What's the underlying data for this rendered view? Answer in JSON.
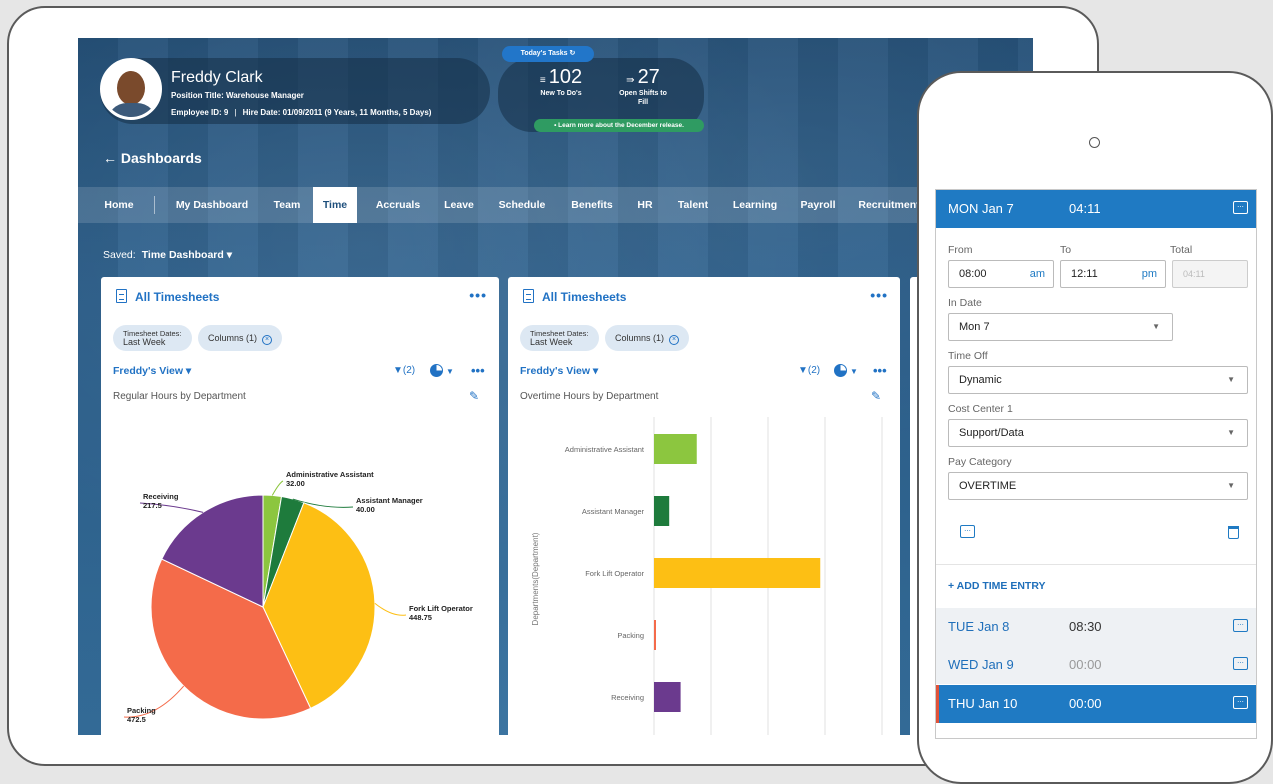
{
  "profile": {
    "name": "Freddy Clark",
    "title": "Position Title: Warehouse Manager",
    "employee_id": "Employee ID: 9",
    "hire_date": "Hire Date: 01/09/2011 (9 Years, 11 Months, 5 Days)"
  },
  "tasks": {
    "label": "Today's Tasks",
    "todos_count": "102",
    "todos_label": "New To Do's",
    "shifts_count": "27",
    "shifts_label_1": "Open Shifts to",
    "shifts_label_2": "Fill",
    "learn_more": "• Learn more about the December release."
  },
  "page": {
    "back_label": "← Dashboards",
    "saved_label": "Saved:",
    "saved_value": "Time Dashboard ▾"
  },
  "nav": [
    "Home",
    "My Dashboard",
    "Team",
    "Time",
    "Accruals",
    "Leave",
    "Schedule",
    "Benefits",
    "HR",
    "Talent",
    "Learning",
    "Payroll",
    "Recruitment"
  ],
  "nav_active": "Time",
  "cards": [
    {
      "title": "All Timesheets",
      "chip_1a": "Timesheet Dates:",
      "chip_1b": "Last Week",
      "chip_2": "Columns (1)",
      "view": "Freddy's View ▾",
      "filter": "(2)",
      "subtitle": "Regular Hours by Department"
    },
    {
      "title": "All Timesheets",
      "chip_1a": "Timesheet Dates:",
      "chip_1b": "Last Week",
      "chip_2": "Columns (1)",
      "view": "Freddy's View ▾",
      "filter": "(2)",
      "subtitle": "Overtime Hours by Department"
    }
  ],
  "chart_data": [
    {
      "type": "pie",
      "title": "Regular Hours by Department",
      "categories": [
        "Administrative Assistant",
        "Assistant Manager",
        "Fork Lift Operator",
        "Packing",
        "Receiving"
      ],
      "values": [
        32.0,
        40.0,
        448.75,
        472.5,
        217.5
      ],
      "value_labels": [
        "32.00",
        "40.00",
        "448.75",
        "472.5",
        "217.5"
      ],
      "colors": [
        "#8cc63f",
        "#1e7b3c",
        "#fdbf14",
        "#f46b4a",
        "#6b3a8e"
      ]
    },
    {
      "type": "bar",
      "orientation": "horizontal",
      "title": "Overtime Hours by Department",
      "ylabel": "Departments(Department)",
      "categories": [
        "Administrative Assistant",
        "Assistant Manager",
        "Fork Lift Operator",
        "Packing",
        "Receiving"
      ],
      "values": [
        4.5,
        1.6,
        17.5,
        0.2,
        2.8
      ],
      "colors": [
        "#8cc63f",
        "#1e7b3c",
        "#fdbf14",
        "#f46b4a",
        "#6b3a8e"
      ],
      "xlim": [
        0,
        24
      ],
      "grid": true
    }
  ],
  "phone": {
    "header_day": "MON  Jan 7",
    "header_time": "04:11",
    "from_label": "From",
    "to_label": "To",
    "total_label": "Total",
    "from_value": "08:00",
    "from_suffix": "am",
    "to_value": "12:11",
    "to_suffix": "pm",
    "total_value": "04:11",
    "in_date_label": "In Date",
    "in_date_value": "Mon 7",
    "time_off_label": "Time Off",
    "time_off_value": "Dynamic",
    "cost_center_label": "Cost Center 1",
    "cost_center_value": "Support/Data",
    "pay_category_label": "Pay Category",
    "pay_category_value": "OVERTIME",
    "add_entry": "+  ADD TIME ENTRY",
    "days": [
      {
        "day": "TUE   Jan 8",
        "time": "08:30"
      },
      {
        "day": "WED   Jan 9",
        "time": "00:00"
      },
      {
        "day": "THU   Jan 10",
        "time": "00:00"
      }
    ]
  }
}
